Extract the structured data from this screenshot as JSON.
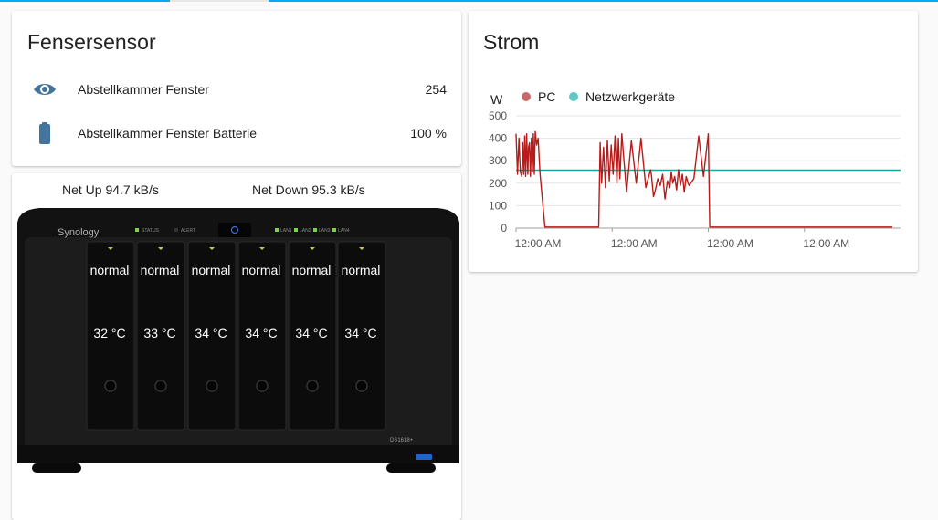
{
  "sensor_card": {
    "title": "Fensersensor",
    "rows": [
      {
        "icon": "eye-icon",
        "name": "Abstellkammer Fenster",
        "value": "254"
      },
      {
        "icon": "battery-icon",
        "name": "Abstellkammer Fenster Batterie",
        "value": "100 %"
      }
    ],
    "accent": "#44739e"
  },
  "power_card": {
    "title": "Strom",
    "chart_data": {
      "type": "line",
      "ylabel": "W",
      "ylim": [
        0,
        500
      ],
      "yticks": [
        "500",
        "400",
        "300",
        "200",
        "100",
        "0"
      ],
      "xticks": [
        "12:00 AM",
        "12:00 AM",
        "12:00 AM",
        "12:00 AM"
      ],
      "grid": true,
      "legend_position": "top-left",
      "series": [
        {
          "name": "PC",
          "color": "#b71c1c",
          "legend_color": "#c9686a",
          "x": [
            0,
            0.3,
            0.6,
            0.9,
            1.2,
            1.4,
            1.6,
            1.8,
            2.0,
            2.2,
            2.45,
            2.6,
            2.8,
            3.0,
            3.2,
            3.4,
            3.6,
            3.8,
            4.0,
            4.3,
            4.6,
            5.0,
            6.0,
            7.0,
            7.5,
            8.0,
            8.2,
            8.4,
            8.6,
            8.8,
            9.0,
            9.2,
            9.4,
            9.6,
            9.8,
            10.0,
            10.3,
            10.5,
            10.8,
            11.0,
            11.2,
            11.6,
            12.0,
            13.0,
            14.0,
            14.5,
            15.0,
            15.3,
            15.6,
            16.0,
            16.3,
            16.6,
            16.9,
            17.2,
            17.5,
            17.8,
            18.2,
            18.6,
            19.0,
            19.4,
            19.8,
            20.2,
            20.6,
            21.0,
            21.3,
            21.6,
            22.0,
            23.0,
            24.0,
            25.0,
            26.0,
            27.0,
            28.0,
            28.2,
            28.6,
            29.0,
            29.5,
            30.0,
            30.5,
            31.0,
            31.5,
            32.0,
            32.3,
            32.6,
            33.0,
            33.4,
            33.8,
            34.2,
            34.6,
            35.0,
            35.4,
            35.8,
            36.0,
            37.0,
            38.0,
            39.0,
            40.0,
            40.3,
            40.6,
            41.0,
            41.3,
            41.6,
            42.0,
            42.3,
            42.6,
            43.0,
            43.3,
            43.6,
            44.0,
            44.4,
            44.8,
            45.2,
            45.6,
            46.0,
            46.3,
            46.6,
            47.0,
            47.3,
            47.5,
            48.0,
            49.0,
            50.0,
            51.0,
            51.3,
            51.6,
            52.0,
            52.3,
            52.6,
            53.0,
            53.3,
            53.6,
            54.0,
            54.3,
            54.6,
            55.0,
            55.4,
            55.8,
            56.2,
            56.6,
            57.0,
            57.3,
            57.6,
            58.0,
            58.3,
            58.6,
            59.0,
            59.3,
            59.6,
            60.0,
            60.4,
            60.8,
            61.0,
            62.0,
            63.0,
            64.0,
            65.0,
            66.0,
            66.2,
            66.5,
            66.8,
            67.1,
            67.4,
            67.7,
            68.0,
            68.3,
            68.6,
            69.0,
            69.3,
            69.6,
            70.0,
            70.3,
            70.6,
            71.0,
            71.3,
            71.6,
            72.0,
            72.3,
            72.6,
            73.0,
            73.3,
            73.6,
            74.0,
            74.3,
            74.6,
            75.0,
            75.3,
            75.6,
            76.0,
            76.3,
            76.6,
            77.0,
            77.3,
            77.6,
            78.0,
            78.3,
            78.6,
            79.0,
            79.3,
            79.6,
            80.0
          ],
          "y": [
            420,
            240,
            400,
            250,
            230,
            380,
            240,
            410,
            230,
            420,
            240,
            360,
            380,
            230,
            400,
            250,
            420,
            240,
            430,
            370,
            400,
            240,
            5,
            5,
            5,
            5,
            5,
            5,
            5,
            5,
            5,
            5,
            5,
            5,
            5,
            5,
            5,
            5,
            5,
            5,
            5,
            5,
            5,
            5,
            5,
            5,
            5,
            5,
            5,
            5,
            5,
            5,
            5,
            5,
            380,
            200,
            360,
            180,
            390,
            210,
            370,
            240,
            410,
            200,
            400,
            220,
            420,
            160,
            390,
            200,
            400,
            180,
            260,
            230,
            140,
            170,
            220,
            190,
            240,
            130,
            210,
            180,
            250,
            200,
            230,
            170,
            260,
            190,
            240,
            160,
            230,
            200,
            190,
            220,
            410,
            230,
            420,
            5,
            5,
            5,
            5,
            5,
            5,
            5,
            5,
            5,
            5,
            5,
            5,
            5,
            5,
            5,
            5,
            5,
            5,
            5,
            5,
            5,
            5,
            5,
            5,
            5,
            5,
            5,
            5,
            5,
            5,
            5,
            5,
            5,
            5,
            5,
            5,
            5,
            5,
            5,
            5,
            5,
            5,
            5,
            5,
            5,
            5,
            5,
            5,
            5,
            5,
            5,
            5,
            5,
            5,
            5,
            5,
            5,
            5,
            5,
            5,
            5,
            5,
            5,
            5,
            5,
            5,
            5,
            5,
            5,
            5,
            5,
            5,
            5,
            5,
            5,
            5,
            5,
            5,
            5,
            5,
            5,
            5,
            5,
            5,
            5,
            5,
            5,
            5,
            5,
            5,
            5,
            5,
            5,
            5,
            5,
            5,
            5,
            5
          ]
        },
        {
          "name": "Netzwerkgeräte",
          "color": "#17a2a5",
          "legend_color": "#5ec9c4",
          "x": [
            0,
            80
          ],
          "y": [
            258,
            258
          ]
        }
      ]
    }
  },
  "nas_card": {
    "net_up": "Net Up 94.7 kB/s",
    "net_down": "Net Down 95.3 kB/s",
    "brand": "Synology",
    "model": "DS1618+",
    "front_labels": [
      "STATUS",
      "ALERT",
      "LAN1",
      "LAN2",
      "LAN3",
      "LAN4"
    ],
    "bays": [
      {
        "status": "normal",
        "temp": "32 °C"
      },
      {
        "status": "normal",
        "temp": "33 °C"
      },
      {
        "status": "normal",
        "temp": "34 °C"
      },
      {
        "status": "normal",
        "temp": "34 °C"
      },
      {
        "status": "normal",
        "temp": "34 °C"
      },
      {
        "status": "normal",
        "temp": "34 °C"
      }
    ]
  }
}
